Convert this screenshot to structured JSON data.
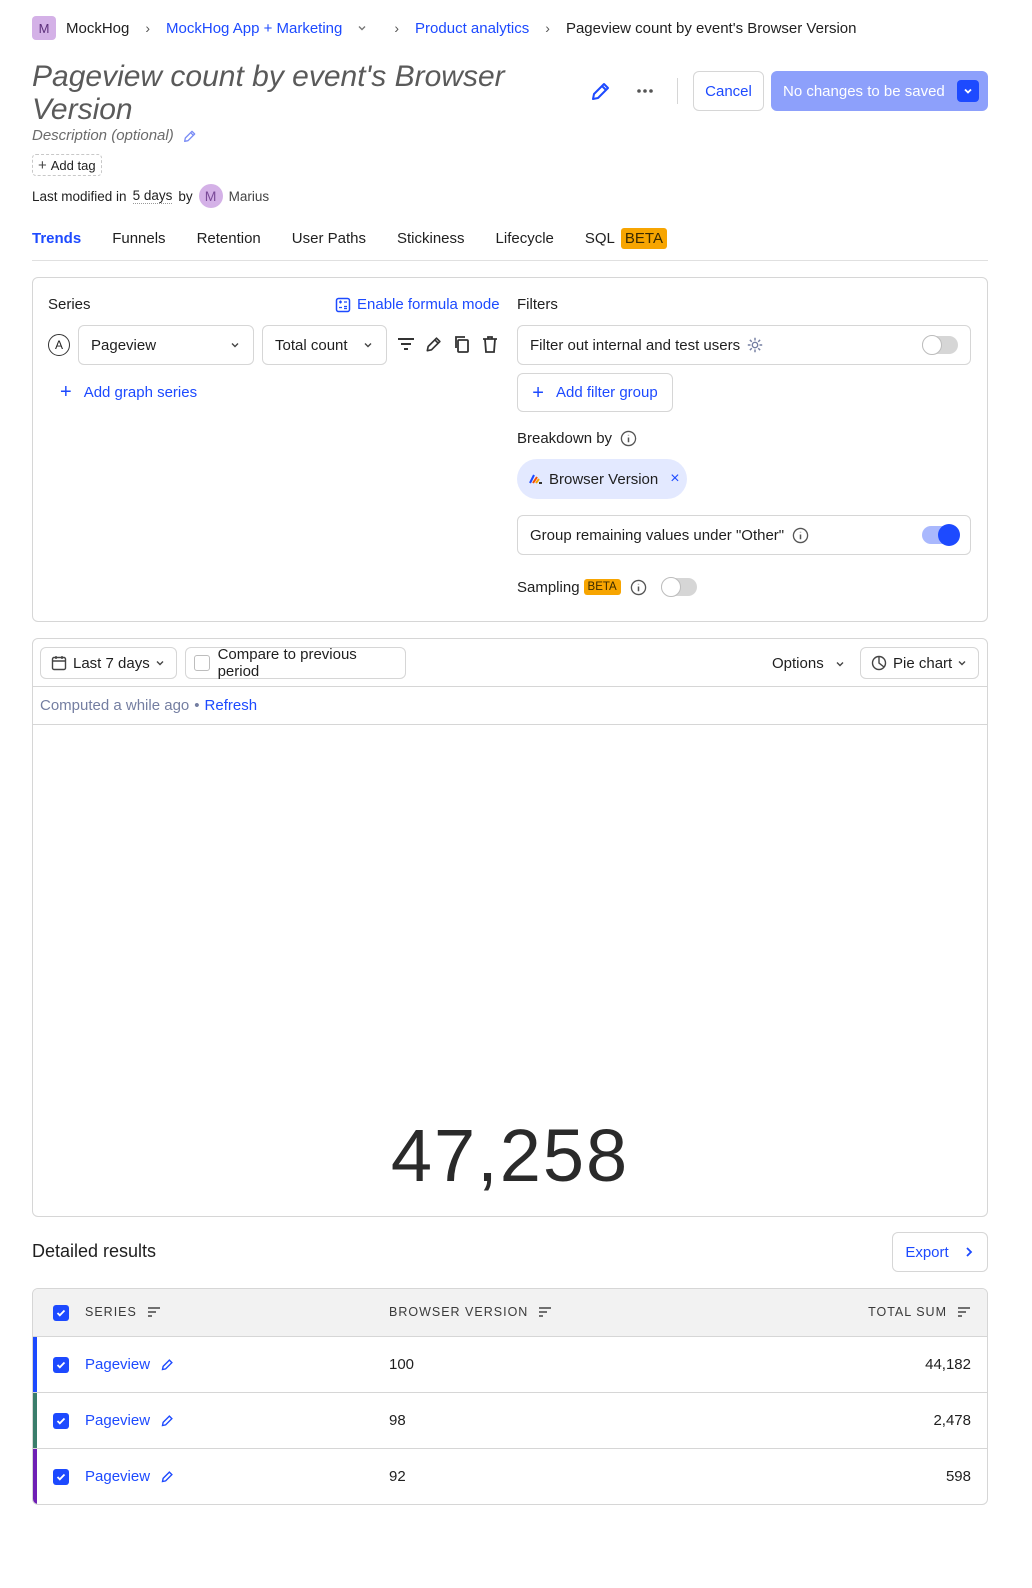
{
  "breadcrumb": {
    "org_initial": "M",
    "org": "MockHog",
    "project": "MockHog App + Marketing",
    "section": "Product analytics",
    "current": "Pageview count by event's Browser Version"
  },
  "header": {
    "title": "Pageview count by event's Browser Version",
    "description_placeholder": "Description (optional)",
    "add_tag": "Add tag",
    "last_modified_prefix": "Last modified in",
    "last_modified_when": "5 days",
    "last_modified_by": "by",
    "author_initial": "M",
    "author": "Marius",
    "cancel": "Cancel",
    "save": "No changes to be saved"
  },
  "tabs": [
    {
      "label": "Trends",
      "active": true
    },
    {
      "label": "Funnels"
    },
    {
      "label": "Retention"
    },
    {
      "label": "User Paths"
    },
    {
      "label": "Stickiness"
    },
    {
      "label": "Lifecycle"
    },
    {
      "label": "SQL",
      "badge": "BETA"
    }
  ],
  "series": {
    "heading": "Series",
    "formula_mode": "Enable formula mode",
    "letter": "A",
    "event": "Pageview",
    "aggregation": "Total count",
    "add_series": "Add graph series"
  },
  "filters": {
    "heading": "Filters",
    "internal_users": "Filter out internal and test users",
    "add_filter_group": "Add filter group",
    "breakdown_heading": "Breakdown by",
    "breakdown_value": "Browser Version",
    "group_other": "Group remaining values under \"Other\"",
    "sampling": "Sampling",
    "sampling_badge": "BETA"
  },
  "chart_controls": {
    "date_range": "Last 7 days",
    "compare": "Compare to previous period",
    "options": "Options",
    "chart_type": "Pie chart",
    "computed": "Computed a while ago",
    "refresh": "Refresh"
  },
  "chart_data": {
    "type": "pie",
    "total_label": "47,258",
    "categories": [
      "100",
      "98",
      "92"
    ],
    "values": [
      44182,
      2478,
      598
    ]
  },
  "results": {
    "heading": "Detailed results",
    "export": "Export",
    "columns": [
      "SERIES",
      "BROWSER VERSION",
      "TOTAL SUM"
    ],
    "rows": [
      {
        "series": "Pageview",
        "version": "100",
        "total": "44,182",
        "color": "#1d4aff"
      },
      {
        "series": "Pageview",
        "version": "98",
        "total": "2,478",
        "color": "#3a7d6b"
      },
      {
        "series": "Pageview",
        "version": "92",
        "total": "598",
        "color": "#6f1fb5"
      }
    ]
  },
  "colors": {
    "accent": "#1d4aff",
    "beta": "#f7a501"
  }
}
